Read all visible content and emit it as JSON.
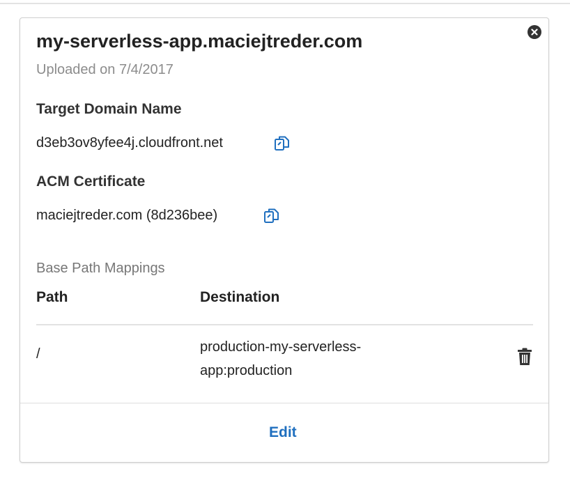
{
  "card": {
    "domain_name": "my-serverless-app.maciejtreder.com",
    "uploaded": "Uploaded on 7/4/2017",
    "close_icon": "close-circle-icon"
  },
  "target_domain": {
    "label": "Target Domain Name",
    "value": "d3eb3ov8yfee4j.cloudfront.net",
    "icon": "copy-icon"
  },
  "acm_certificate": {
    "label": "ACM Certificate",
    "value": "maciejtreder.com (8d236bee)",
    "icon": "copy-icon"
  },
  "base_path_mappings": {
    "heading": "Base Path Mappings",
    "columns": [
      "Path",
      "Destination"
    ],
    "rows": [
      {
        "path": "/",
        "destination_line1": "production-my-serverless-",
        "destination_line2": "app:production",
        "action_icon": "trash-icon"
      }
    ]
  },
  "footer": {
    "edit_label": "Edit"
  },
  "colors": {
    "accent": "#1f6fbf",
    "muted_text": "#8c8c8c",
    "border": "#cfcfcf"
  }
}
